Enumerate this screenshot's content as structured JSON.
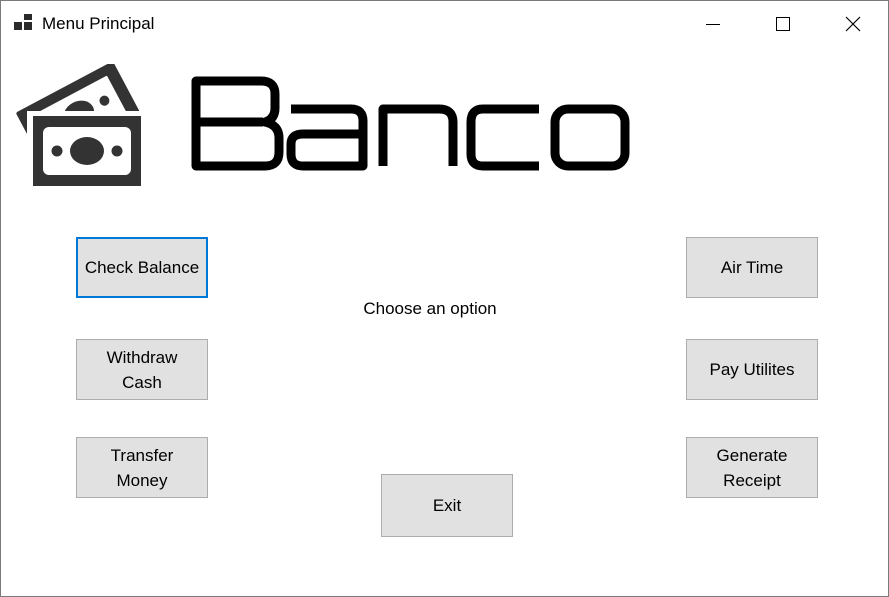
{
  "window": {
    "title": "Menu Principal",
    "app_icon": "window-tiles-icon",
    "controls": {
      "minimize_icon": "minimize-icon",
      "maximize_icon": "maximize-icon",
      "close_icon": "close-icon"
    }
  },
  "header": {
    "logo_icon": "money-bills-icon",
    "brand_text": "Banco"
  },
  "main": {
    "prompt": "Choose an option",
    "buttons": {
      "check_balance": "Check Balance",
      "withdraw_cash": "Withdraw\nCash",
      "transfer_money": "Transfer\nMoney",
      "air_time": "Air Time",
      "pay_utilities": "Pay Utilites",
      "generate_receipt": "Generate\nReceipt",
      "exit": "Exit"
    },
    "focused_button": "check_balance"
  },
  "colors": {
    "button_face": "#e1e1e1",
    "button_border": "#adadad",
    "focus_border": "#0078d7",
    "logo": "#333333",
    "brand": "#000000"
  }
}
